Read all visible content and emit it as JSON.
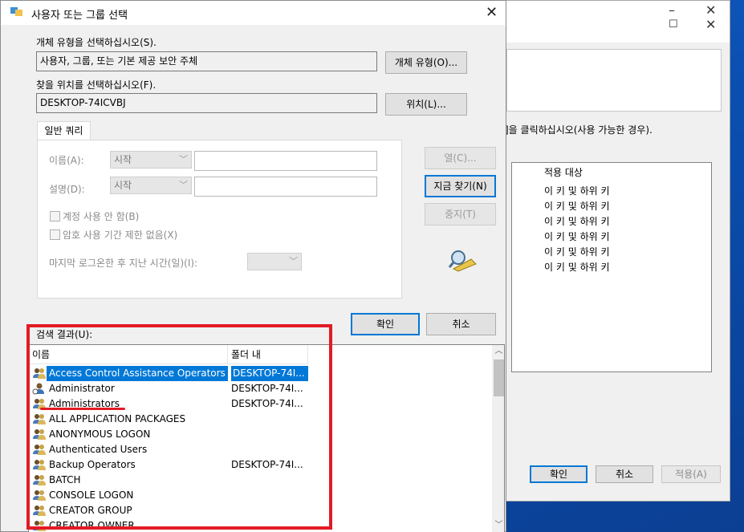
{
  "background_window": {
    "hint_text": "]을 클릭하십시오(사용 가능한 경우).",
    "perm_header": "적용 대상",
    "perm_rows": [
      "이 키 및 하위 키",
      "이 키 및 하위 키",
      "이 키 및 하위 키",
      "이 키 및 하위 키",
      "이 키 및 하위 키",
      "이 키 및 하위 키"
    ],
    "buttons": {
      "ok": "확인",
      "cancel": "취소",
      "apply": "적용(A)"
    }
  },
  "dialog": {
    "title": "사용자 또는 그룹 선택",
    "object_type": {
      "label": "개체 유형을 선택하십시오(S).",
      "value": "사용자, 그룹, 또는 기본 제공 보안 주체",
      "button": "개체 유형(O)..."
    },
    "location": {
      "label": "찾을 위치를 선택하십시오(F).",
      "value": "DESKTOP-74ICVBJ",
      "button": "위치(L)..."
    },
    "tab_label": "일반 쿼리",
    "query": {
      "name_label": "이름(A):",
      "name_op": "시작",
      "desc_label": "설명(D):",
      "desc_op": "시작",
      "disabled_accounts": "계정 사용 안 함(B)",
      "non_expiring_pw": "암호 사용 기간 제한 없음(X)",
      "days_since_logon": "마지막 로그온한 후 지난 시간(일)(I):"
    },
    "side_buttons": {
      "columns": "열(C)...",
      "find_now": "지금 찾기(N)",
      "stop": "중지(T)"
    },
    "ok": "확인",
    "cancel": "취소",
    "results": {
      "label": "검색 결과(U):",
      "col_name": "이름",
      "col_folder": "폴더 내",
      "rows": [
        {
          "name": "Access Control Assistance Operators",
          "folder": "DESKTOP-74I...",
          "selected": true,
          "icon": "group-icon"
        },
        {
          "name": "Administrator",
          "folder": "DESKTOP-74I...",
          "selected": false,
          "icon": "user-icon"
        },
        {
          "name": "Administrators",
          "folder": "DESKTOP-74I...",
          "selected": false,
          "icon": "group-icon"
        },
        {
          "name": "ALL APPLICATION PACKAGES",
          "folder": "",
          "selected": false,
          "icon": "group-icon"
        },
        {
          "name": "ANONYMOUS LOGON",
          "folder": "",
          "selected": false,
          "icon": "group-icon"
        },
        {
          "name": "Authenticated Users",
          "folder": "",
          "selected": false,
          "icon": "group-icon"
        },
        {
          "name": "Backup Operators",
          "folder": "DESKTOP-74I...",
          "selected": false,
          "icon": "group-icon"
        },
        {
          "name": "BATCH",
          "folder": "",
          "selected": false,
          "icon": "group-icon"
        },
        {
          "name": "CONSOLE LOGON",
          "folder": "",
          "selected": false,
          "icon": "group-icon"
        },
        {
          "name": "CREATOR GROUP",
          "folder": "",
          "selected": false,
          "icon": "group-icon"
        },
        {
          "name": "CREATOR OWNER",
          "folder": "",
          "selected": false,
          "icon": "group-icon"
        }
      ]
    }
  },
  "colors": {
    "selection": "#0078d7",
    "annotation": "#e21b24",
    "desktop": "#0a4fb0"
  }
}
